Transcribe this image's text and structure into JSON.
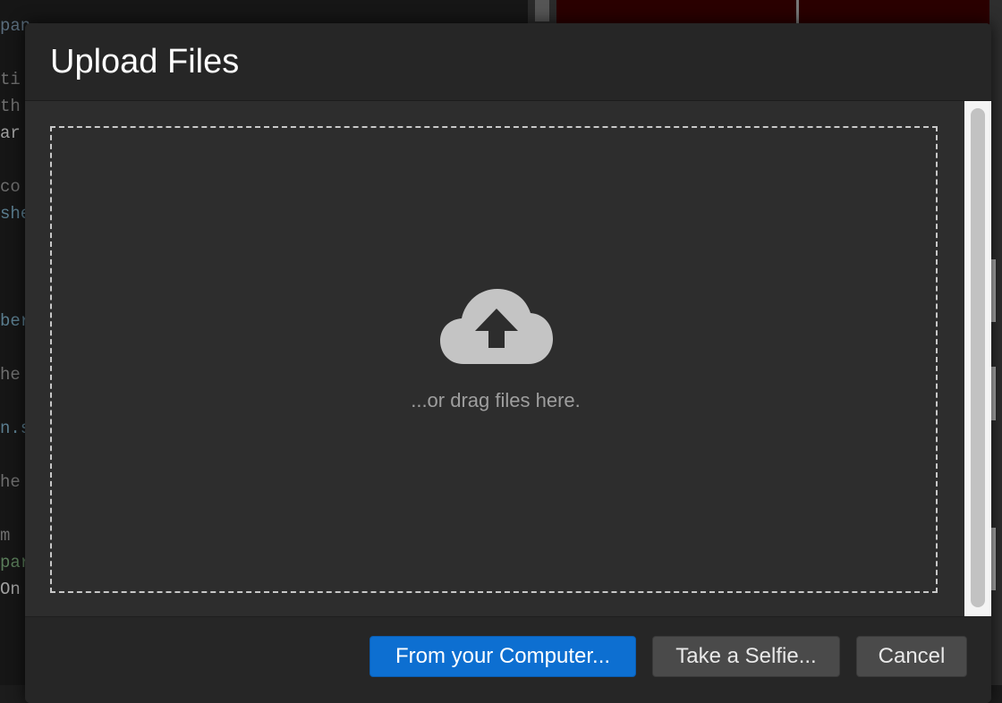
{
  "dialog": {
    "title": "Upload Files",
    "drop_hint": "...or drag files here.",
    "buttons": {
      "from_computer": "From your Computer...",
      "take_selfie": "Take a Selfie...",
      "cancel": "Cancel"
    }
  },
  "background_editor": {
    "lines": [
      "pan",
      "ti",
      "th",
      "ar",
      "co",
      "she",
      "ber",
      "he",
      "n.s",
      "he",
      "m",
      "par",
      "On"
    ]
  },
  "colors": {
    "primary_button": "#0d6fd1",
    "dialog_bg": "#2d2d2d",
    "header_bg": "#262626",
    "drop_border": "#c8c8c8",
    "icon": "#c4c4c4"
  },
  "icons": {
    "upload": "cloud-upload-icon"
  }
}
